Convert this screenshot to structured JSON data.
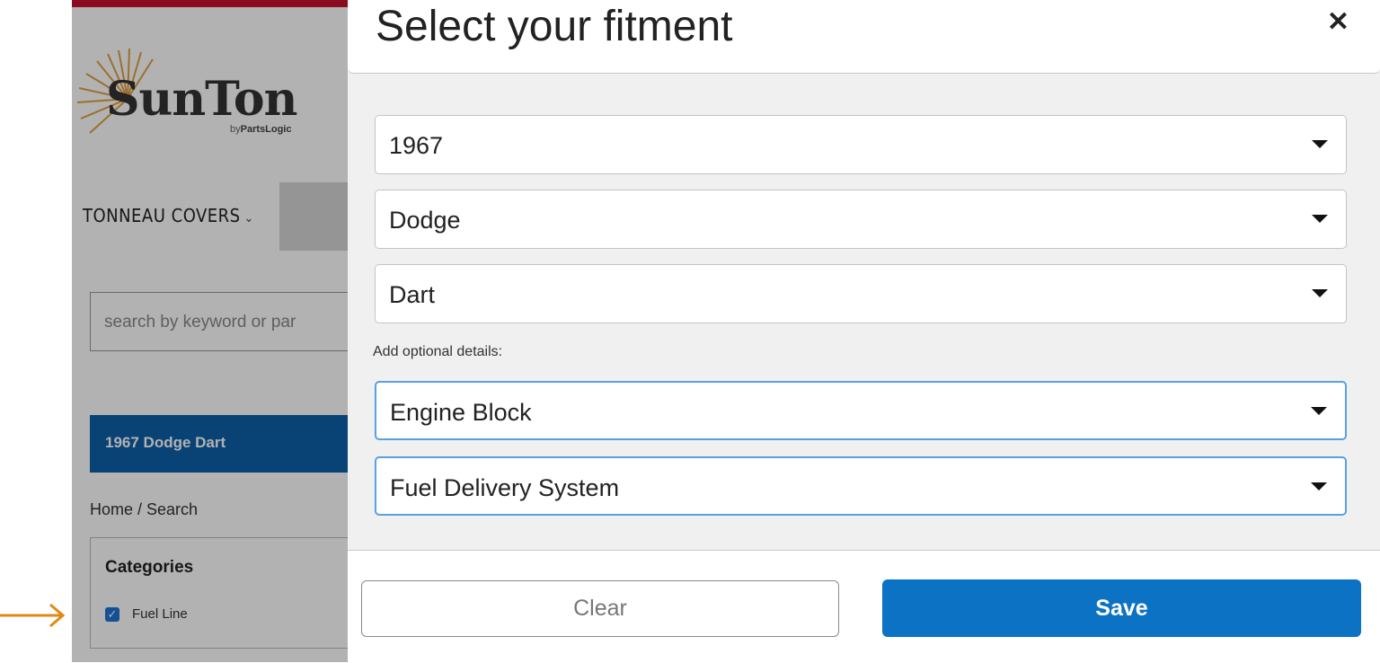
{
  "background_page": {
    "logo_text": "SunTon",
    "logo_byline_prefix": "by",
    "logo_byline_brand": "PartsLogic",
    "nav_item_label": "TONNEAU COVERS",
    "search_placeholder": "search by keyword or par",
    "vehicle_label": "1967 Dodge Dart",
    "breadcrumb": "Home / Search",
    "categories_title": "Categories",
    "category_item": "Fuel Line",
    "category_checked": true
  },
  "modal": {
    "title": "Select your fitment",
    "close_icon": "close-icon",
    "year_value": "1967",
    "make_value": "Dodge",
    "model_value": "Dart",
    "optional_label": "Add optional details:",
    "engine_value": "Engine Block",
    "fuel_value": "Fuel Delivery System",
    "clear_label": "Clear",
    "save_label": "Save"
  },
  "colors": {
    "brand_blue": "#0b72c4",
    "vehicle_bar_blue": "#0d5fa6",
    "top_bar_red": "#c8102e",
    "annotation_arrow": "#e08a16"
  }
}
